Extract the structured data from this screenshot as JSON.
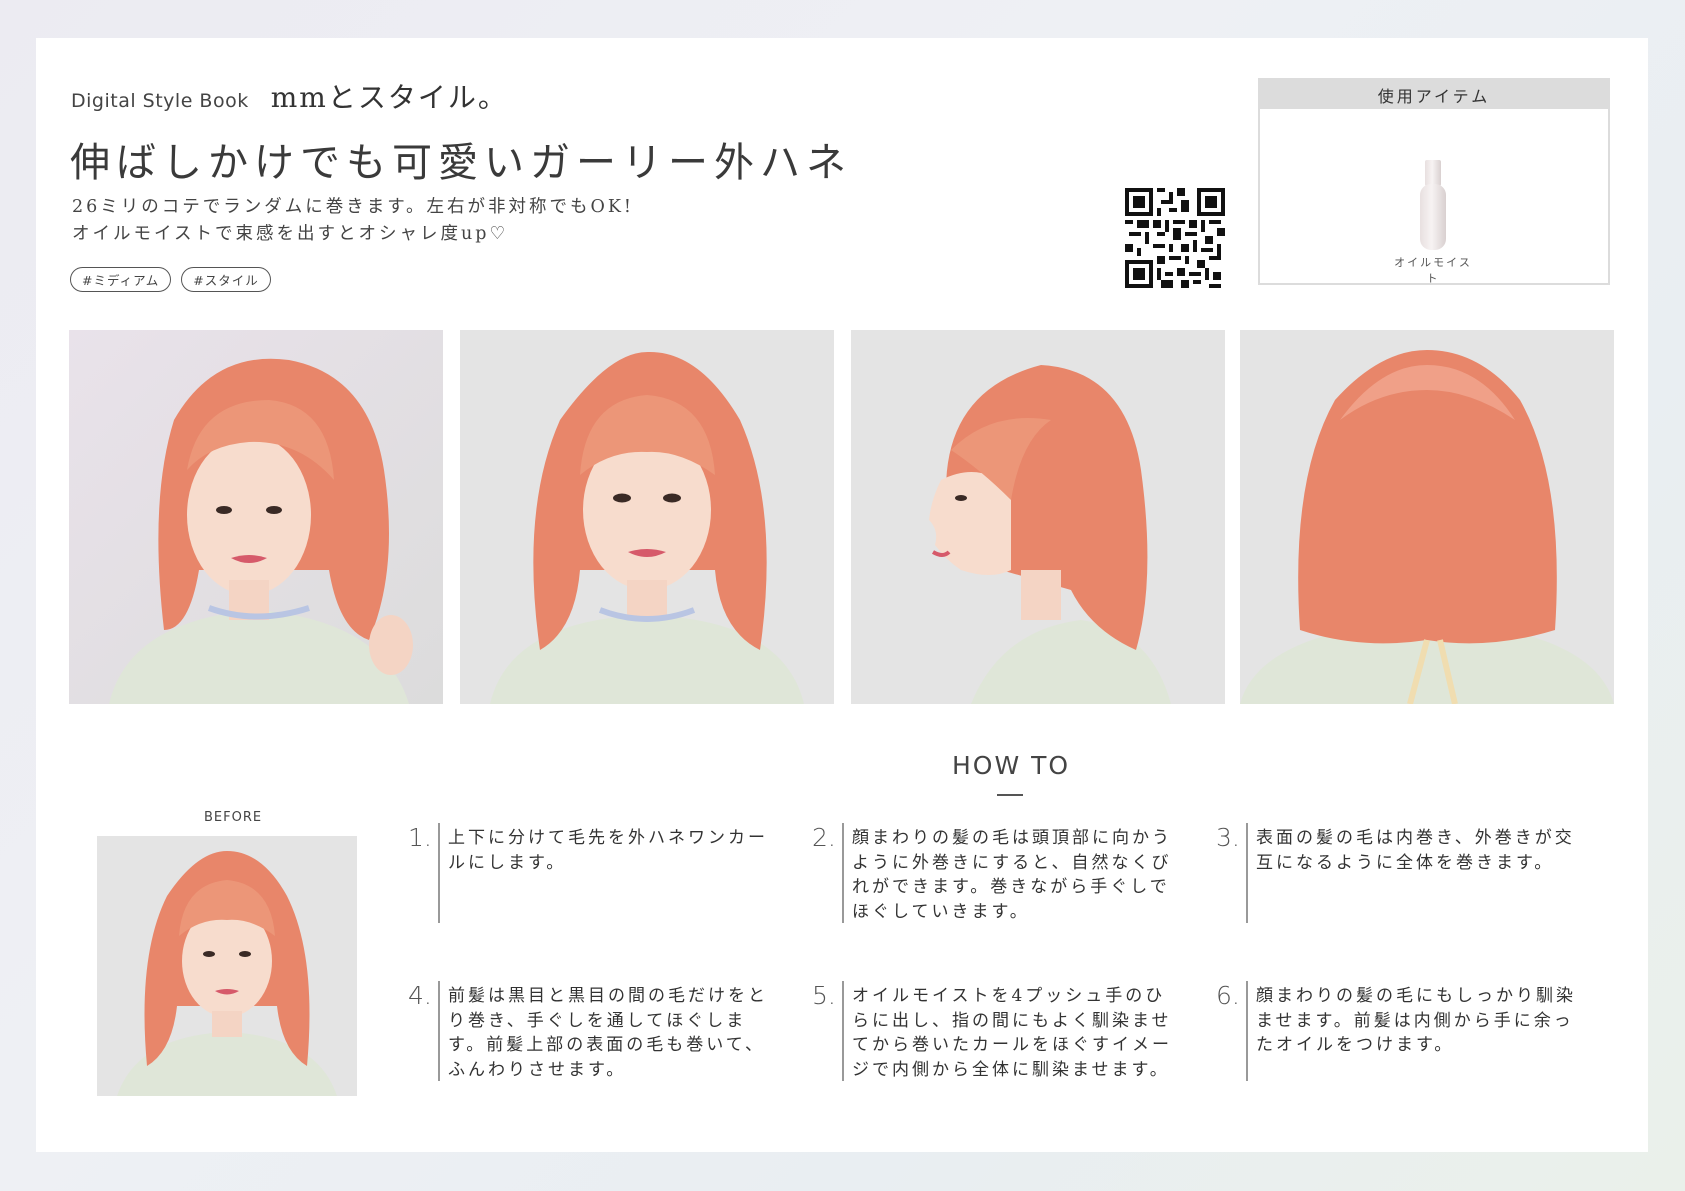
{
  "header": {
    "brand_en": "Digital Style Book",
    "brand_jp": "mmとスタイル。",
    "title": "伸ばしかけでも可愛いガーリー外ハネ",
    "description": [
      "26ミリのコテでランダムに巻きます。左右が非対称でもOK!",
      "オイルモイストで束感を出すとオシャレ度up♡"
    ],
    "tags": [
      "#ミディアム",
      "#スタイル"
    ]
  },
  "items": {
    "heading": "使用アイテム",
    "product_label": "オイルモイスト"
  },
  "howto": {
    "title": "HOW TO",
    "before_label": "BEFORE",
    "steps": [
      {
        "num": "1.",
        "text": "上下に分けて毛先を外ハネワンカールにします。"
      },
      {
        "num": "2.",
        "text": "顔まわりの髪の毛は頭頂部に向かうように外巻きにすると、自然なくびれができます。巻きながら手ぐしでほぐしていきます。"
      },
      {
        "num": "3.",
        "text": "表面の髪の毛は内巻き、外巻きが交互になるように全体を巻きます。"
      },
      {
        "num": "4.",
        "text": "前髪は黒目と黒目の間の毛だけをとり巻き、手ぐしを通してほぐします。前髪上部の表面の毛も巻いて、ふんわりさせます。"
      },
      {
        "num": "5.",
        "text": "オイルモイストを4プッシュ手のひらに出し、指の間にもよく馴染ませてから巻いたカールをほぐすイメージで内側から全体に馴染ませます。"
      },
      {
        "num": "6.",
        "text": "顔まわりの髪の毛にもしっかり馴染ませます。前髪は内側から手に余ったオイルをつけます。"
      }
    ]
  },
  "colors": {
    "hair": "#e8866a",
    "hair_light": "#f2a58e",
    "skin": "#f7dccd",
    "blouse": "#dfe6d8",
    "bg_photo": "#e4e4e4"
  }
}
